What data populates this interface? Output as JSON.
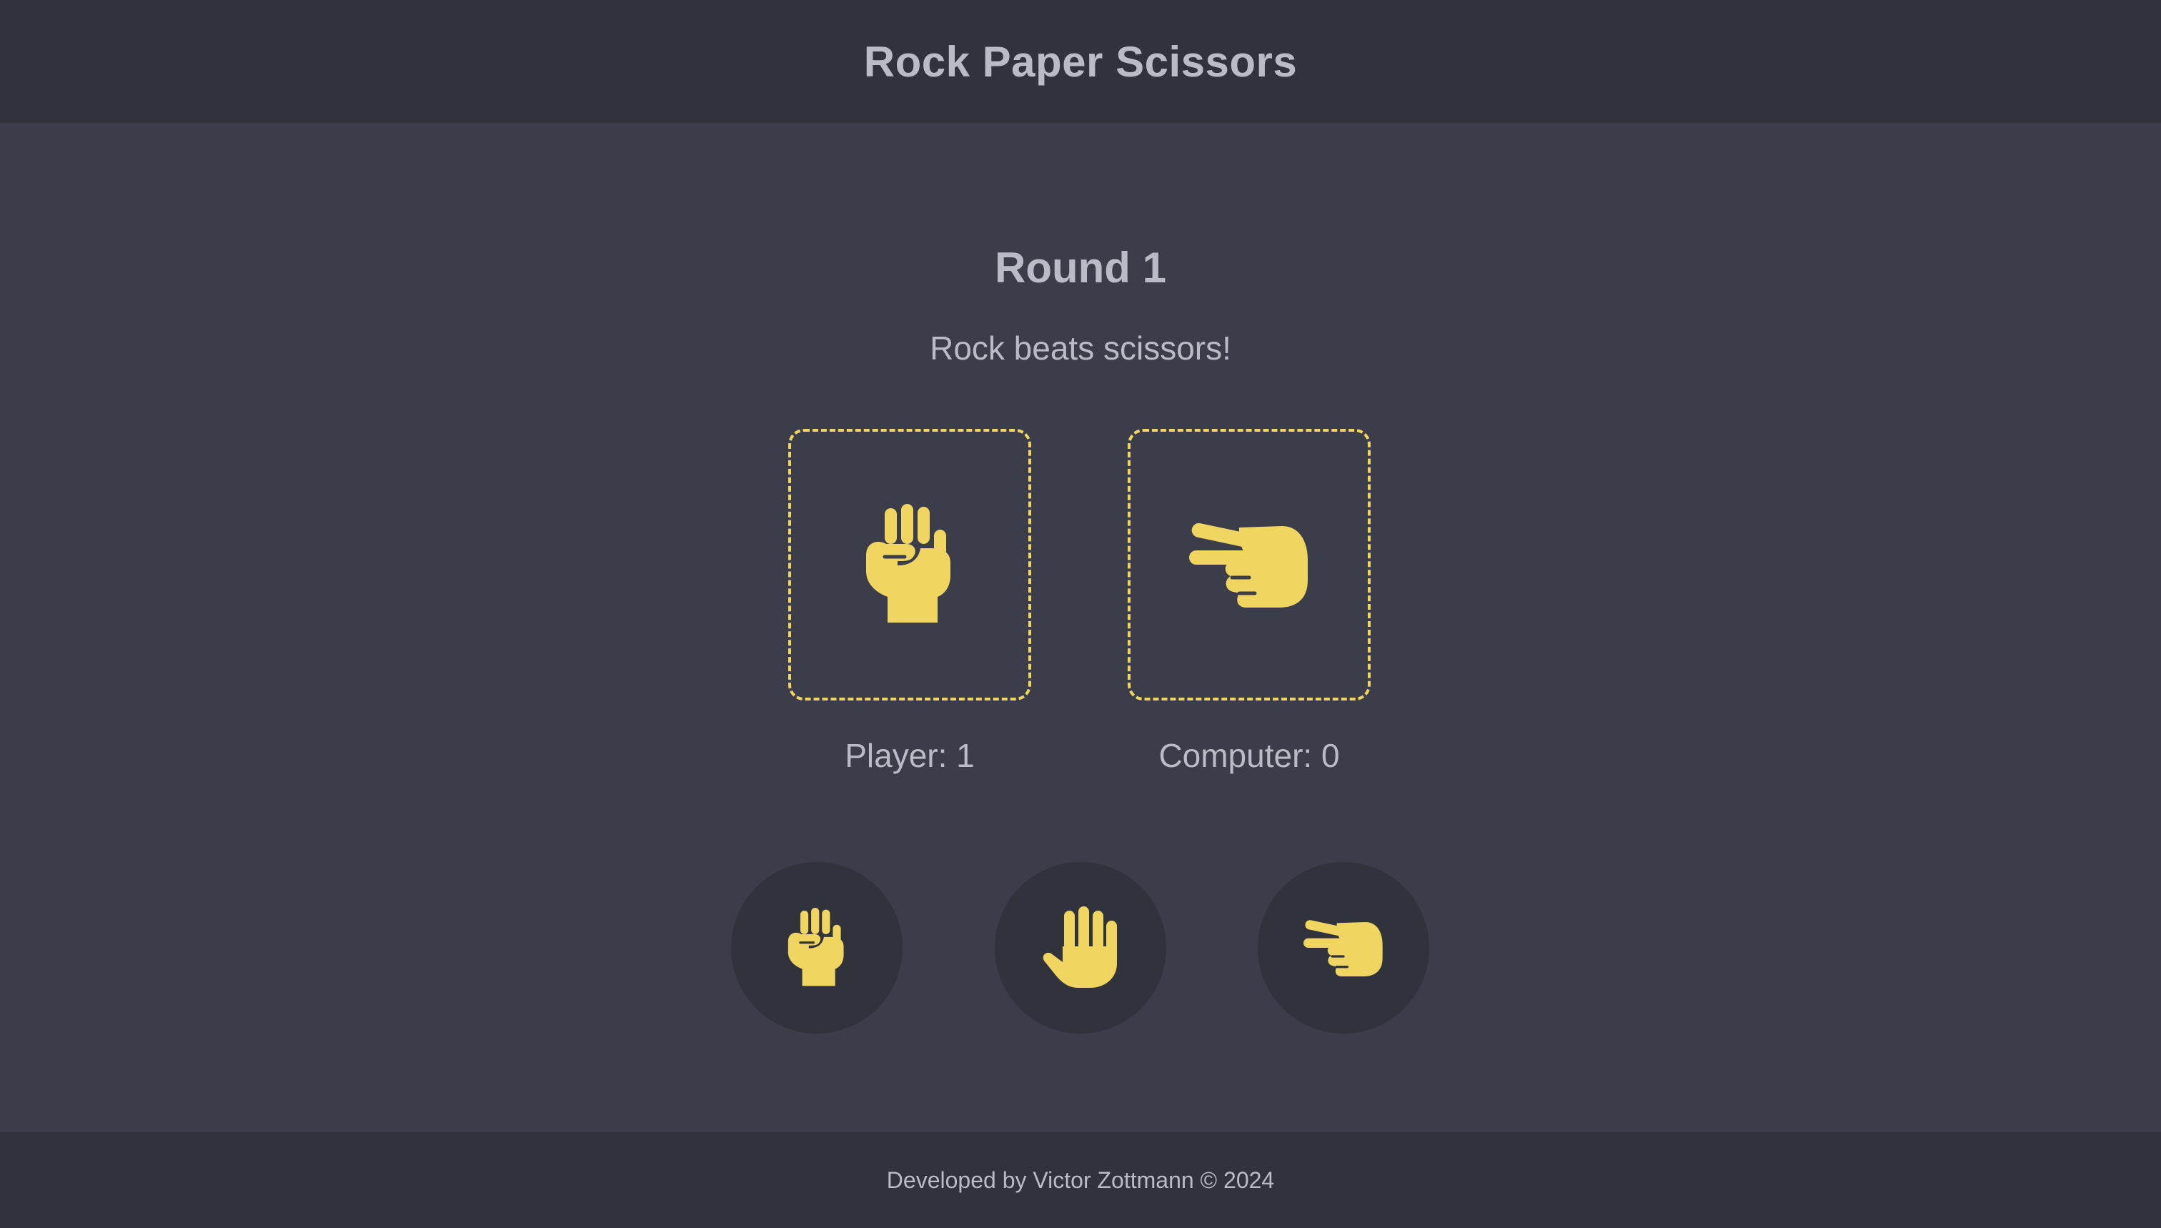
{
  "header": {
    "title": "Rock Paper Scissors"
  },
  "game": {
    "round_label": "Round 1",
    "result_text": "Rock beats scissors!",
    "player": {
      "label": "Player:",
      "score": "1",
      "choice_icon": "rock-fist-icon"
    },
    "computer": {
      "label": "Computer:",
      "score": "0",
      "choice_icon": "scissors-hand-icon"
    }
  },
  "controls": {
    "buttons": [
      {
        "id": "rock",
        "icon": "rock-fist-icon"
      },
      {
        "id": "paper",
        "icon": "paper-hand-icon"
      },
      {
        "id": "scissors",
        "icon": "scissors-hand-icon"
      }
    ]
  },
  "footer": {
    "text": "Developed by Victor Zottmann © 2024"
  },
  "colors": {
    "accent": "#f0d661",
    "header_bg": "#30323c",
    "main_bg": "#3b3e4a",
    "text": "#b9bcc6"
  }
}
